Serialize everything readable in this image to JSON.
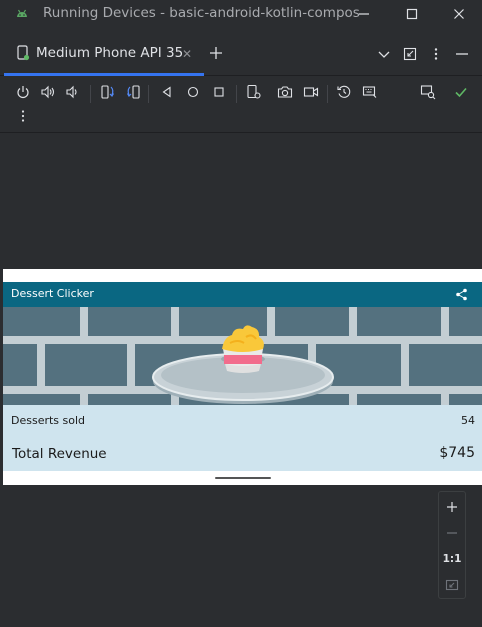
{
  "window": {
    "title": "Running Devices - basic-android-kotlin-compos"
  },
  "tabs": [
    {
      "label": "Medium Phone API 35"
    }
  ],
  "colors": {
    "accent": "#3574f0",
    "app_bar": "#0a6782",
    "stats_bg": "#cfe4ee",
    "check_green": "#5fb865"
  },
  "toolbar": {
    "icons": [
      "power-icon",
      "volume-up-icon",
      "volume-down-icon",
      "rotate-left-icon",
      "rotate-right-icon",
      "back-icon",
      "home-icon",
      "overview-icon",
      "device-settings-icon",
      "screenshot-icon",
      "screen-record-icon",
      "reset-icon",
      "keyboard-icon",
      "device-mirror-icon",
      "check-icon",
      "more-icon"
    ]
  },
  "app": {
    "title": "Dessert Clicker",
    "desserts_sold_label": "Desserts sold",
    "desserts_sold_value": "54",
    "total_revenue_label": "Total Revenue",
    "total_revenue_value": "$745"
  },
  "zoom": {
    "one_to_one": "1:1"
  }
}
